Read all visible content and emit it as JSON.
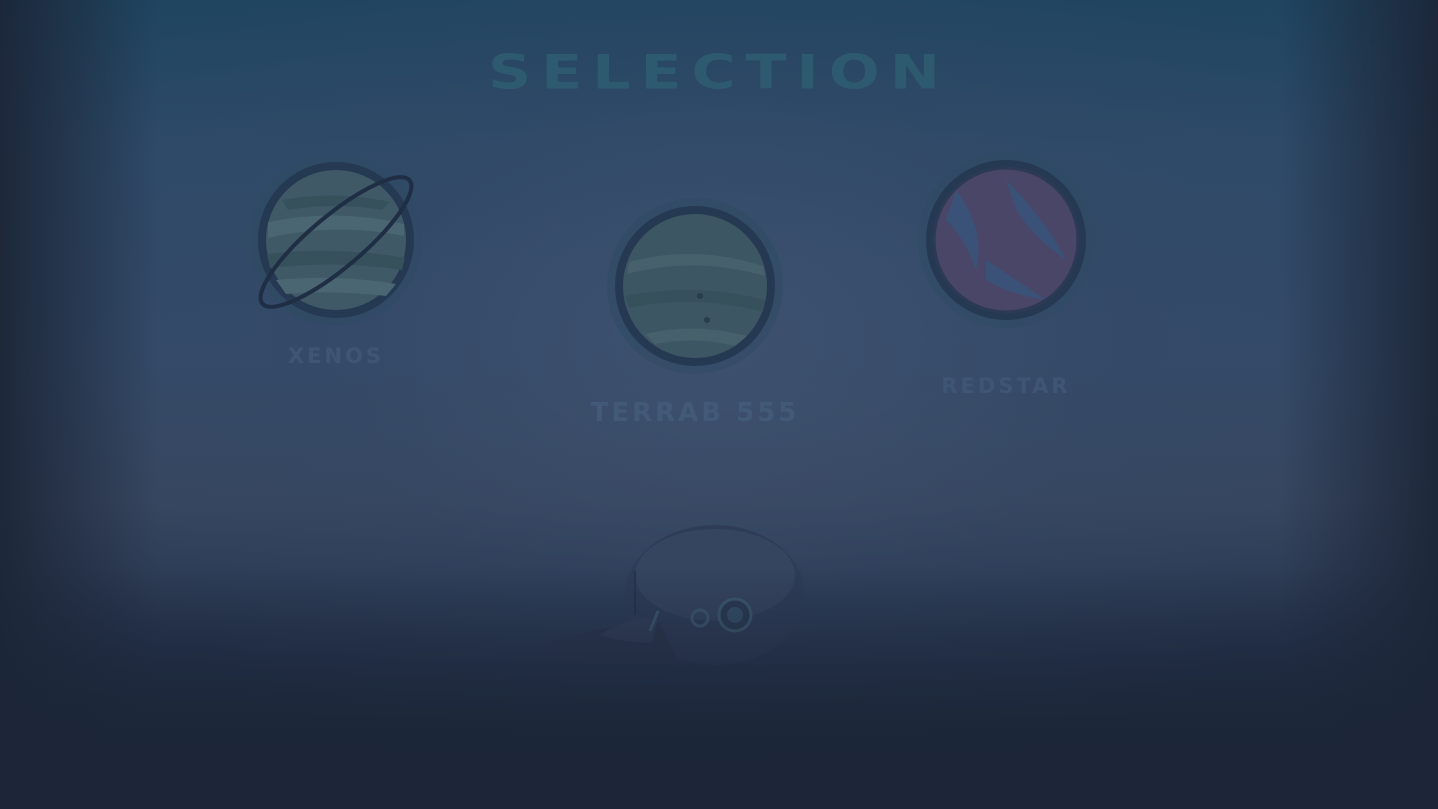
{
  "screen": {
    "title": "SELECTION"
  },
  "planets": [
    {
      "name": "XENOS",
      "icon": "ringed-planet-icon",
      "color": "#3f5a66"
    },
    {
      "name": "TERRAB 555",
      "icon": "planet-icon",
      "color": "#3d5663"
    },
    {
      "name": "REDSTAR",
      "icon": "red-planet-icon",
      "color": "#4a4668"
    }
  ],
  "player": {
    "icon": "spaceship-icon"
  },
  "colors": {
    "background": "#1c2638",
    "title": "#2e5a70",
    "label": "#3e5574"
  }
}
